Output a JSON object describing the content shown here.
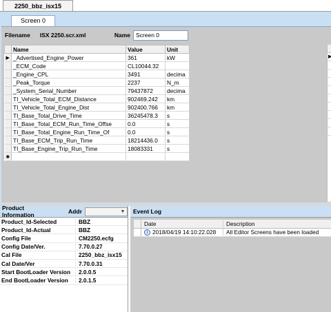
{
  "doc_tab": {
    "label": "2250_bbz_isx15"
  },
  "screen_tab": {
    "label": "Screen 0"
  },
  "file": {
    "filename_label": "Filename",
    "filename_value": "ISX 2250.scr.xml",
    "name_label": "Name",
    "name_value": "Screen 0"
  },
  "params": {
    "headers": {
      "name": "Name",
      "value": "Value",
      "unit": "Unit"
    },
    "rows": [
      {
        "name": "_Advertised_Engine_Power",
        "value": "361",
        "unit": "kW"
      },
      {
        "name": "_ECM_Code",
        "value": "CL10044.32",
        "unit": ""
      },
      {
        "name": "_Engine_CPL",
        "value": "3491",
        "unit": "decima"
      },
      {
        "name": "_Peak_Torque",
        "value": "2237",
        "unit": "N_m"
      },
      {
        "name": "_System_Serial_Number",
        "value": "79437872",
        "unit": "decima"
      },
      {
        "name": "TI_Vehicle_Total_ECM_Distance",
        "value": "902469.242",
        "unit": "km"
      },
      {
        "name": "TI_Vehicle_Total_Engine_Dist",
        "value": "902400.766",
        "unit": "km"
      },
      {
        "name": "TI_Base_Total_Drive_Time",
        "value": "36245478.3",
        "unit": "s"
      },
      {
        "name": "TI_Base_Total_ECM_Run_Time_Offse",
        "value": "0.0",
        "unit": "s"
      },
      {
        "name": "TI_Base_Total_Engine_Run_Time_Of",
        "value": "0.0",
        "unit": "s"
      },
      {
        "name": "TI_Base_ECM_Trip_Run_Time",
        "value": "18214436.0",
        "unit": "s"
      },
      {
        "name": "TI_Base_Engine_Trip_Run_Time",
        "value": "18083331",
        "unit": "s"
      }
    ],
    "current_row_marker": "▶",
    "new_row_marker": "✱",
    "right_strip_marker": "▶"
  },
  "product": {
    "title": "Product Information",
    "addr_label": "Addr",
    "addr_value": "",
    "rows": [
      {
        "key": "Product_Id-Selected",
        "value": "BBZ"
      },
      {
        "key": "Product_Id-Actual",
        "value": "BBZ"
      },
      {
        "key": "Config File",
        "value": "CM2250.ecfg"
      },
      {
        "key": "Config Date/Ver.",
        "value": "7.70.0.27"
      },
      {
        "key": "Cal File",
        "value": "2250_bbz_isx15"
      },
      {
        "key": "Cal Date/Ver",
        "value": "7.70.0.31"
      },
      {
        "key": "Start BootLoader Version",
        "value": "2.0.0.5"
      },
      {
        "key": "End BootLoader Version",
        "value": "2.0.1.5"
      }
    ]
  },
  "event_log": {
    "title": "Event Log",
    "headers": {
      "date": "Date",
      "description": "Description"
    },
    "rows": [
      {
        "date": "2018/04/19 14:10:22.028",
        "description": "All Editor Screens have been loaded"
      }
    ]
  }
}
